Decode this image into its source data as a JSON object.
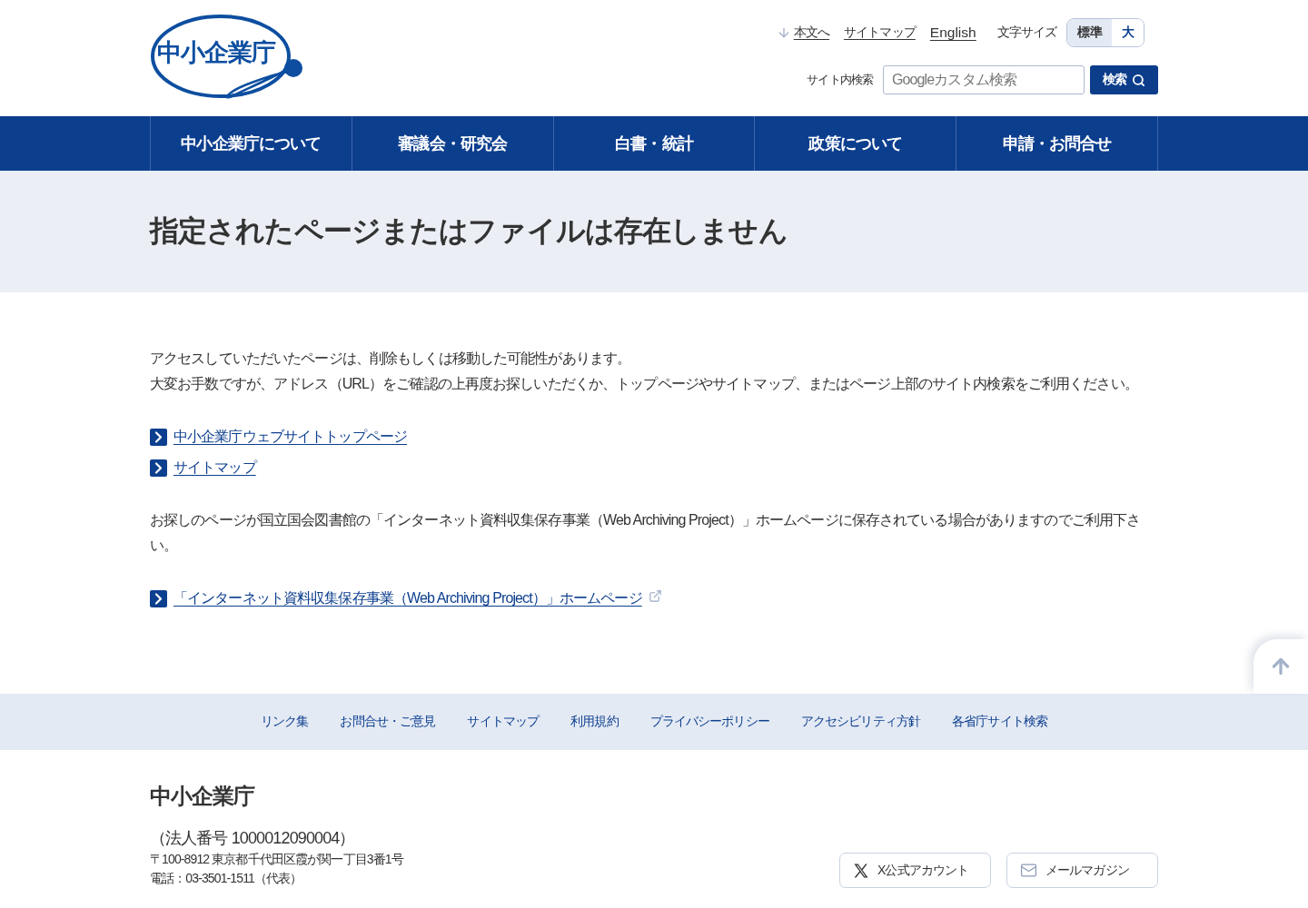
{
  "header": {
    "logo": "中小企業庁",
    "skip_link": "本文へ",
    "links": [
      "サイトマップ",
      "English"
    ],
    "font_size": {
      "label": "文字サイズ",
      "options": [
        {
          "label": "標準",
          "selected": true
        },
        {
          "label": "大",
          "selected": false
        }
      ]
    },
    "search": {
      "label": "サイト内検索",
      "placeholder": "Googleカスタム検索",
      "button": "検索"
    }
  },
  "nav": [
    "中小企業庁について",
    "審議会・研究会",
    "白書・統計",
    "政策について",
    "申請・お問合せ"
  ],
  "page_title": "指定されたページまたはファイルは存在しません",
  "content": [
    {
      "kind": "text",
      "lines": [
        "アクセスしていただいたページは、削除もしくは移動した可能性があります。",
        "大変お手数ですが、アドレス（URL）をご確認の上再度お探しいただくか、トップページやサイトマップ、またはページ上部のサイト内検索をご利用ください。"
      ]
    },
    {
      "kind": "links",
      "items": [
        {
          "label": "中小企業庁ウェブサイトトップページ",
          "external": false
        },
        {
          "label": "サイトマップ",
          "external": false
        }
      ]
    },
    {
      "kind": "text",
      "lines": [
        "お探しのページが国立国会図書館の「インターネット資料収集保存事業（Web Archiving Project）」ホームページに保存されている場合がありますのでご利用下さい。"
      ]
    },
    {
      "kind": "links",
      "items": [
        {
          "label": "「インターネット資料収集保存事業（Web Archiving Project）」ホームページ",
          "external": true
        }
      ]
    }
  ],
  "footer_links": [
    "リンク集",
    "お問合せ・ご意見",
    "サイトマップ",
    "利用規約",
    "プライバシーポリシー",
    "アクセシビリティ方針",
    "各省庁サイト検索"
  ],
  "footer": {
    "name": "中小企業庁",
    "corporate_number": "（法人番号 1000012090004）",
    "address": "〒100-8912 東京都千代田区霞が関一丁目3番1号",
    "phone": "電話：03-3501-1511（代表）",
    "buttons": [
      {
        "kind": "x",
        "label": "X公式アカウント"
      },
      {
        "kind": "mail",
        "label": "メールマガジン"
      }
    ]
  }
}
